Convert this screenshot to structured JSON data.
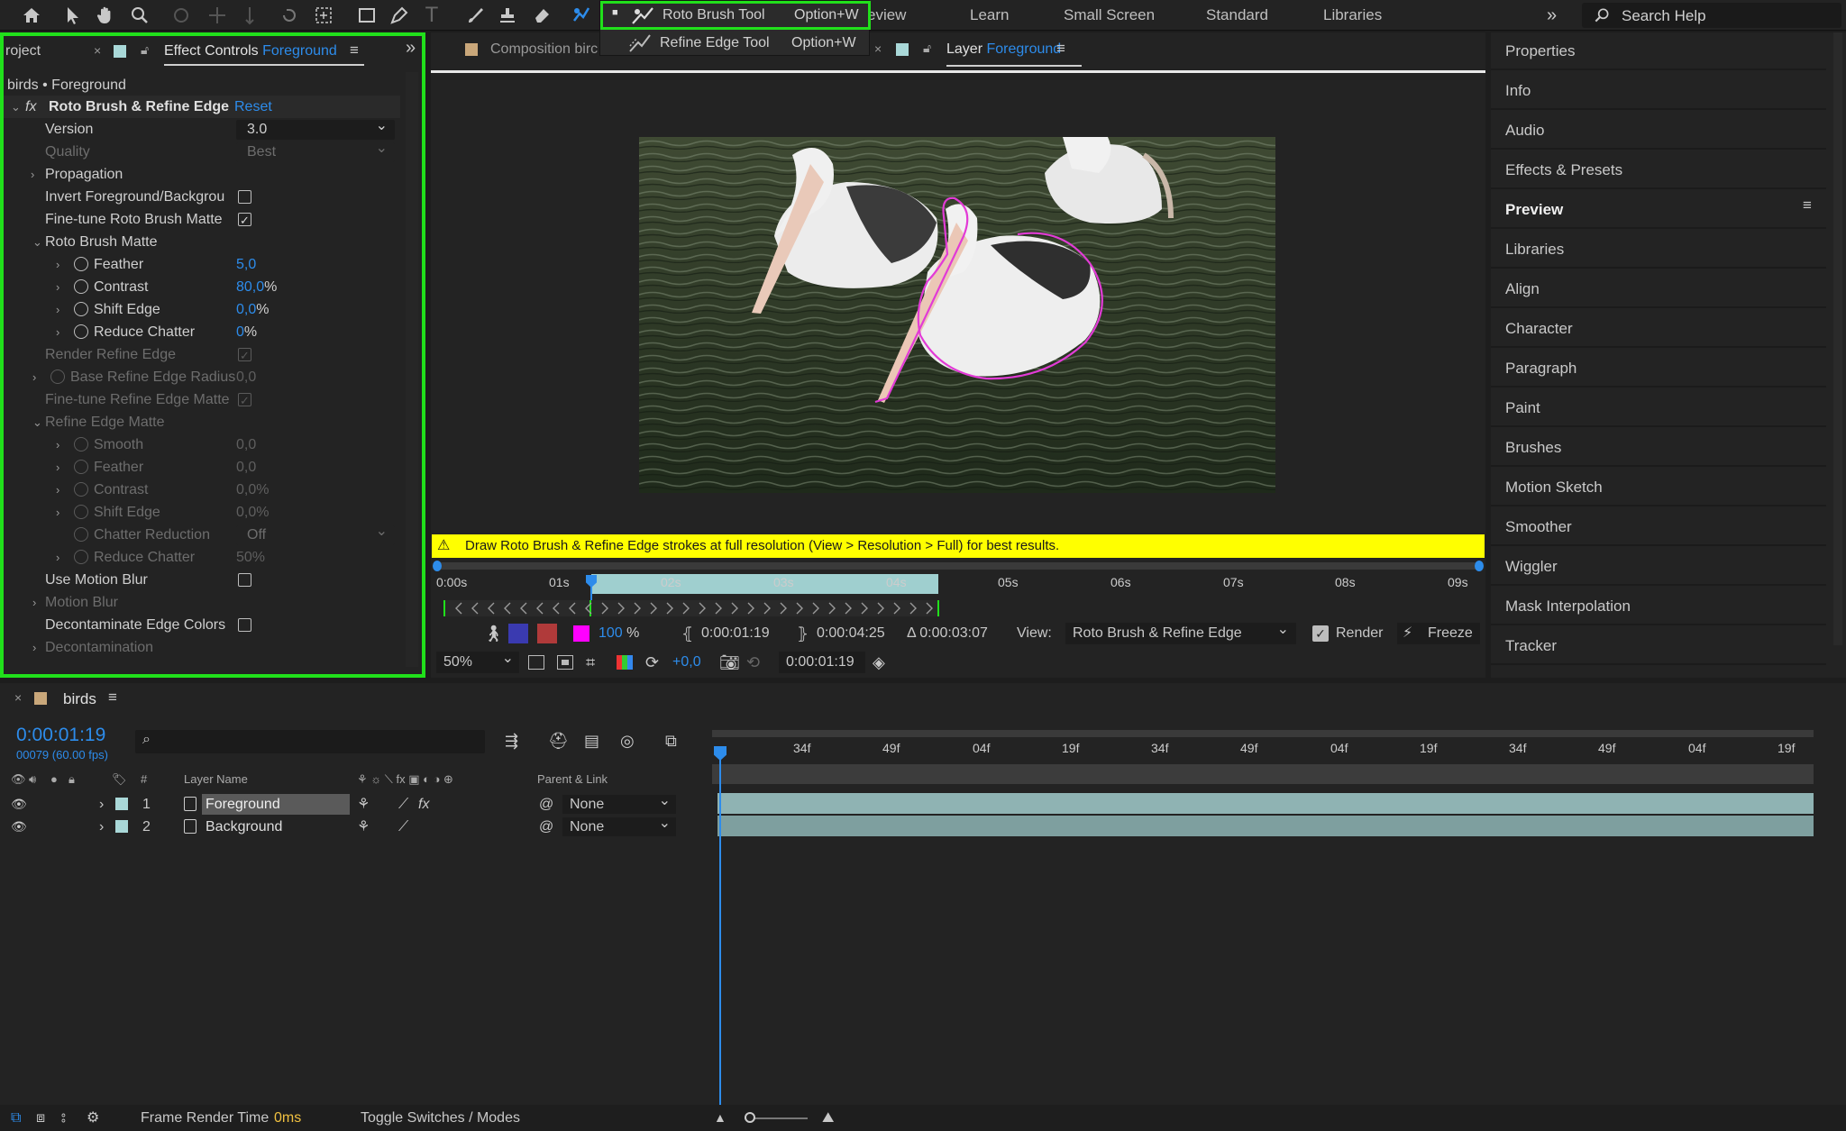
{
  "toolbar": {
    "workspaces": [
      "eview",
      "Learn",
      "Small Screen",
      "Standard",
      "Libraries"
    ],
    "search_placeholder": "Search Help",
    "dropdown": [
      {
        "label": "Roto Brush Tool",
        "shortcut": "Option+W",
        "selected": true
      },
      {
        "label": "Refine Edge Tool",
        "shortcut": "Option+W",
        "selected": false
      }
    ]
  },
  "effect_controls": {
    "project_tab": "roject",
    "tab_label": "Effect Controls",
    "tab_layer": "Foreground",
    "breadcrumb": "birds • Foreground",
    "effect_name": "Roto Brush & Refine Edge",
    "reset_label": "Reset",
    "rows": [
      {
        "label": "Version",
        "value": "3.0"
      },
      {
        "label": "Quality",
        "value": "Best"
      },
      {
        "label": "Propagation"
      },
      {
        "label": "Invert Foreground/Backgrou"
      },
      {
        "label": "Fine-tune Roto Brush Matte"
      },
      {
        "label": "Roto Brush Matte"
      },
      {
        "label": "Feather",
        "value": "5,0"
      },
      {
        "label": "Contrast",
        "value": "80,0",
        "unit": "%"
      },
      {
        "label": "Shift Edge",
        "value": "0,0",
        "unit": "%"
      },
      {
        "label": "Reduce Chatter",
        "value": "0",
        "unit": "%"
      },
      {
        "label": "Render Refine Edge"
      },
      {
        "label": "Base Refine Edge Radius",
        "value": "0,0"
      },
      {
        "label": "Fine-tune Refine Edge Matte"
      },
      {
        "label": "Refine Edge Matte"
      },
      {
        "label": "Smooth",
        "value": "0,0"
      },
      {
        "label": "Feather",
        "value": "0,0"
      },
      {
        "label": "Contrast",
        "value": "0,0%"
      },
      {
        "label": "Shift Edge",
        "value": "0,0%"
      },
      {
        "label": "Chatter Reduction",
        "value": "Off"
      },
      {
        "label": "Reduce Chatter",
        "value": "50%"
      },
      {
        "label": "Use Motion Blur"
      },
      {
        "label": "Motion Blur"
      },
      {
        "label": "Decontaminate Edge Colors"
      },
      {
        "label": "Decontamination"
      }
    ]
  },
  "viewer": {
    "comp_tab": "Composition birc",
    "layer_tab_prefix": "Layer",
    "layer_tab_name": "Foreground",
    "warning": "Draw Roto Brush & Refine Edge strokes at full resolution (View > Resolution > Full) for best results.",
    "ruler": [
      "0:00s",
      "01s",
      "02s",
      "03s",
      "04s",
      "05s",
      "06s",
      "07s",
      "08s",
      "09s"
    ],
    "in_time": "0:00:01:19",
    "out_time": "0:00:04:25",
    "delta": "Δ 0:00:03:07",
    "view_label": "View:",
    "view_value": "Roto Brush & Refine Edge",
    "render_label": "Render",
    "freeze_label": "Freeze",
    "opacity": "100",
    "opacity_unit": "%",
    "zoom": "50%",
    "exposure": "+0,0",
    "timecode": "0:00:01:19"
  },
  "right_panel": [
    "Properties",
    "Info",
    "Audio",
    "Effects & Presets",
    "Preview",
    "Libraries",
    "Align",
    "Character",
    "Paragraph",
    "Paint",
    "Brushes",
    "Motion Sketch",
    "Smoother",
    "Wiggler",
    "Mask Interpolation",
    "Tracker"
  ],
  "timeline": {
    "comp_name": "birds",
    "timecode": "0:00:01:19",
    "frames": "00079 (60.00 fps)",
    "col_num": "#",
    "col_layer": "Layer Name",
    "col_parent": "Parent & Link",
    "ruler": [
      "34f",
      "49f",
      "04f",
      "19f",
      "34f",
      "49f",
      "04f",
      "19f",
      "34f",
      "49f",
      "04f",
      "19f"
    ],
    "layers": [
      {
        "num": "1",
        "name": "Foreground",
        "parent": "None"
      },
      {
        "num": "2",
        "name": "Background",
        "parent": "None"
      }
    ]
  },
  "statusbar": {
    "frame_render_label": "Frame Render Time",
    "frame_render_value": "0ms",
    "toggle_label": "Toggle Switches / Modes"
  }
}
